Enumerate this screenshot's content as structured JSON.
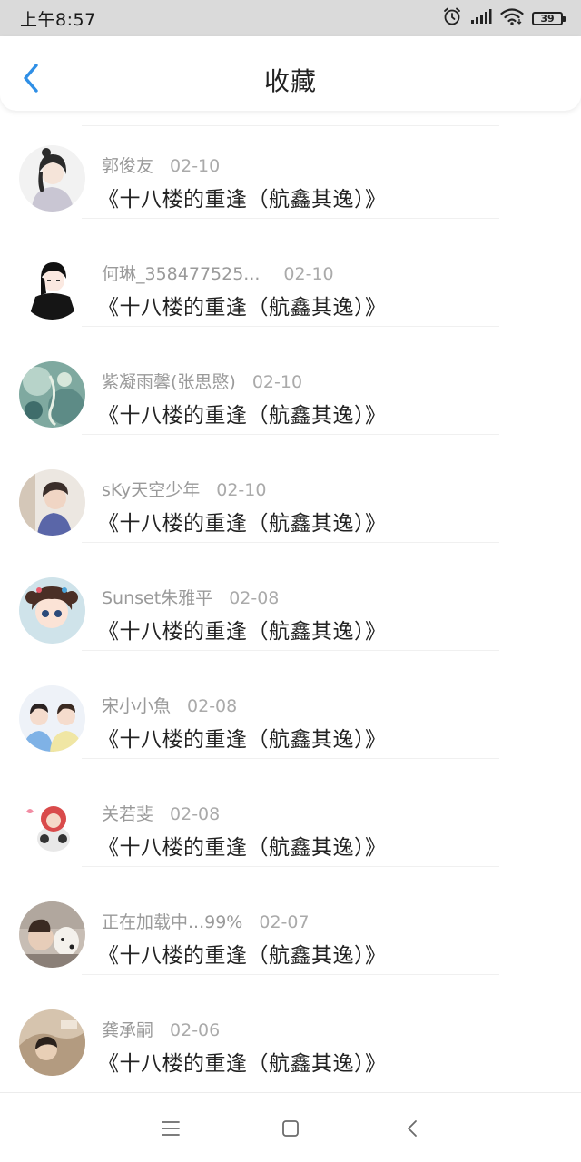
{
  "status_bar": {
    "time": "上午8:57",
    "battery": "39",
    "icons": [
      "alarm-icon",
      "signal-icon",
      "wifi-icon",
      "battery-icon"
    ]
  },
  "header": {
    "title": "收藏",
    "back_icon": "chevron-left-icon",
    "accent_color": "#2f8fe6"
  },
  "favorites": [
    {
      "author": "郭俊友",
      "date": "02-10",
      "title": "《十八楼的重逢（航鑫其逸）》"
    },
    {
      "author": "何琳_358477525...",
      "date": "02-10",
      "title": "《十八楼的重逢（航鑫其逸）》"
    },
    {
      "author": "紫凝雨馨(张思愍)",
      "date": "02-10",
      "title": "《十八楼的重逢（航鑫其逸）》"
    },
    {
      "author": "sKy天空少年",
      "date": "02-10",
      "title": "《十八楼的重逢（航鑫其逸）》"
    },
    {
      "author": "Sunset朱雅平",
      "date": "02-08",
      "title": "《十八楼的重逢（航鑫其逸）》"
    },
    {
      "author": "宋小小魚",
      "date": "02-08",
      "title": "《十八楼的重逢（航鑫其逸）》"
    },
    {
      "author": "关若斐",
      "date": "02-08",
      "title": "《十八楼的重逢（航鑫其逸）》"
    },
    {
      "author": "正在加载中...99%",
      "date": "02-07",
      "title": "《十八楼的重逢（航鑫其逸）》"
    },
    {
      "author": "龚承嗣",
      "date": "02-06",
      "title": "《十八楼的重逢（航鑫其逸）》"
    }
  ],
  "nav_bar": {
    "icons": [
      "menu-icon",
      "home-square-icon",
      "back-triangle-icon"
    ]
  }
}
